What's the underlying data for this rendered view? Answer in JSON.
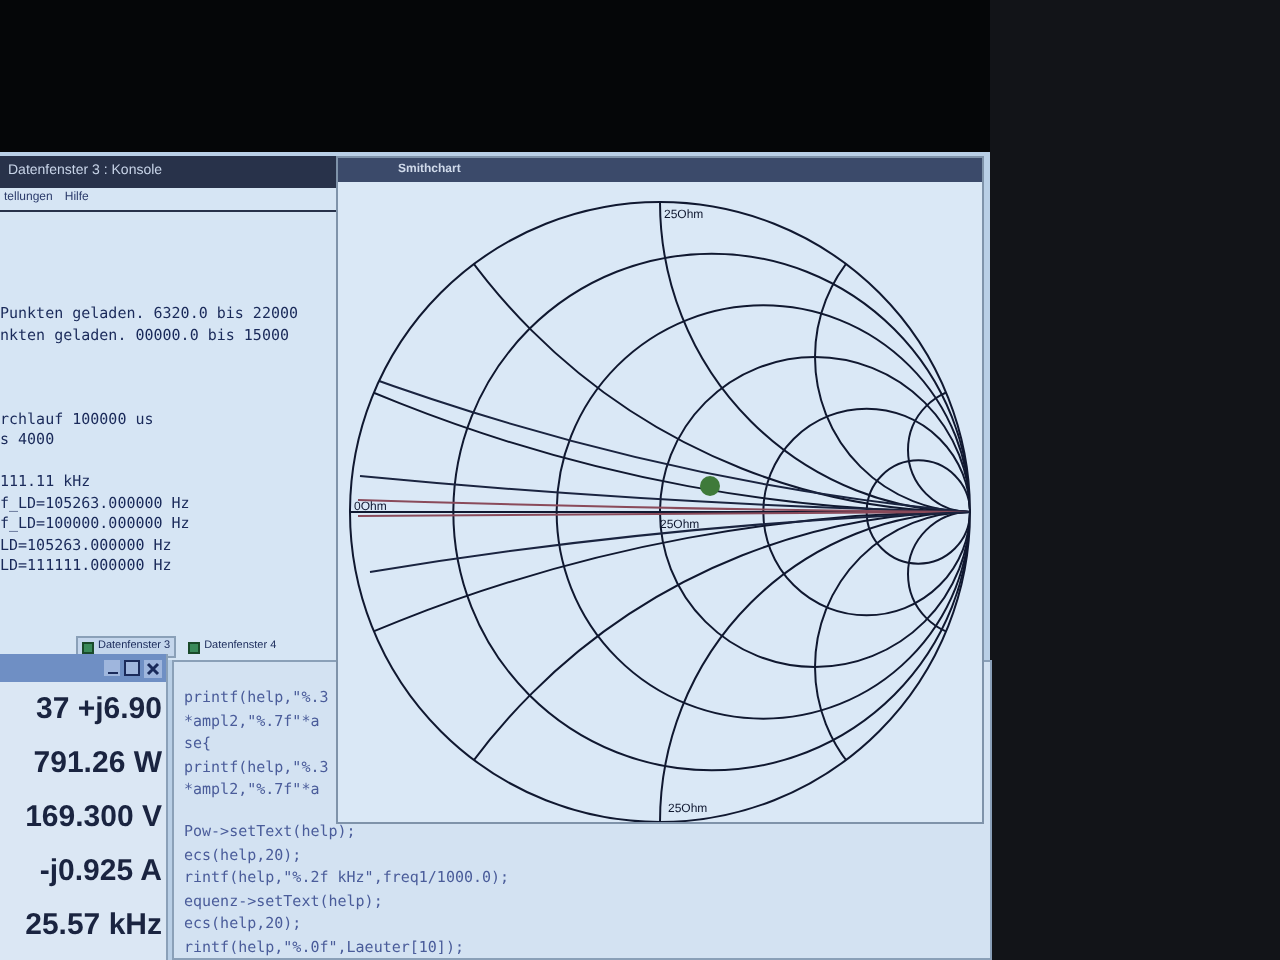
{
  "console": {
    "title": "Datenfenster 3 : Konsole",
    "menu": [
      "tellungen",
      "Hilfe"
    ],
    "blocks": [
      [
        "Punkten geladen. 6320.0 bis 22000",
        "nkten geladen. 00000.0 bis 15000"
      ],
      [
        "rchlauf 100000 us",
        "s 4000"
      ],
      [
        "111.11 kHz",
        "f_LD=105263.000000 Hz",
        "f_LD=100000.000000 Hz",
        "LD=105263.000000 Hz",
        "LD=111111.000000 Hz"
      ]
    ],
    "tabs": [
      {
        "label": "Datenfenster 3",
        "selected": true
      },
      {
        "label": "Datenfenster 4",
        "selected": false
      }
    ]
  },
  "smith_chart": {
    "title": "Smithchart",
    "labels": [
      {
        "kind": "top",
        "text": "25Ohm"
      },
      {
        "kind": "center",
        "text": "25Ohm"
      },
      {
        "kind": "left",
        "text": "0Ohm"
      },
      {
        "kind": "bottom",
        "text": "25Ohm"
      }
    ]
  },
  "readout": {
    "values": [
      "37 +j6.90",
      "791.26 W",
      "169.300 V",
      "-j0.925 A",
      "25.57 kHz"
    ]
  },
  "editor": {
    "blocks": [
      [
        "printf(help,\"%.3",
        "*ampl2,\"%.7f\"*a",
        "se{",
        "printf(help,\"%.3",
        "*ampl2,\"%.7f\"*a"
      ],
      [
        "Pow->setText(help);",
        "ecs(help,20);",
        "rintf(help,\"%.2f kHz\",freq1/1000.0);",
        "equenz->setText(help);",
        "ecs(help,20);",
        "rintf(help,\"%.0f\",Laeuter[10]);"
      ]
    ]
  }
}
